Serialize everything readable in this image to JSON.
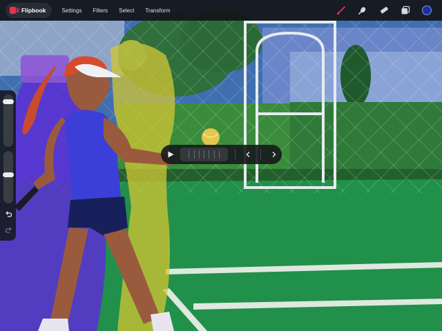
{
  "app": {
    "title": "Flipbook",
    "menu": [
      "Settings",
      "Filters",
      "Select",
      "Transform"
    ]
  },
  "tools": [
    {
      "name": "brush-icon",
      "color": "#e8344f"
    },
    {
      "name": "smudge-icon",
      "color": "#d7dadd"
    },
    {
      "name": "eraser-icon",
      "color": "#d7dadd"
    },
    {
      "name": "layers-icon",
      "color": "#d7dadd"
    }
  ],
  "current_color": "#1a2fa8",
  "sidebar": {
    "brush_size": 0.1,
    "opacity": 0.55
  },
  "playback": {
    "frames_shown": 7
  },
  "palette": {
    "sky": "#3b73b3",
    "trees": "#2f7a3a",
    "court": "#1f8f43",
    "onion_skin_purple": "#5a2fd6",
    "onion_skin_yellow": "#d4c534",
    "shirt": "#3b3fd8",
    "shorts": "#17205a",
    "hair": "#d84a2c",
    "skin": "#9a5a3e",
    "ball": "#e3c64a"
  },
  "icons": {
    "flipbook": "flipbook-icon",
    "play": "play-icon",
    "prev": "chevron-left-icon",
    "next": "chevron-right-icon",
    "undo": "undo-icon",
    "redo": "redo-icon"
  }
}
